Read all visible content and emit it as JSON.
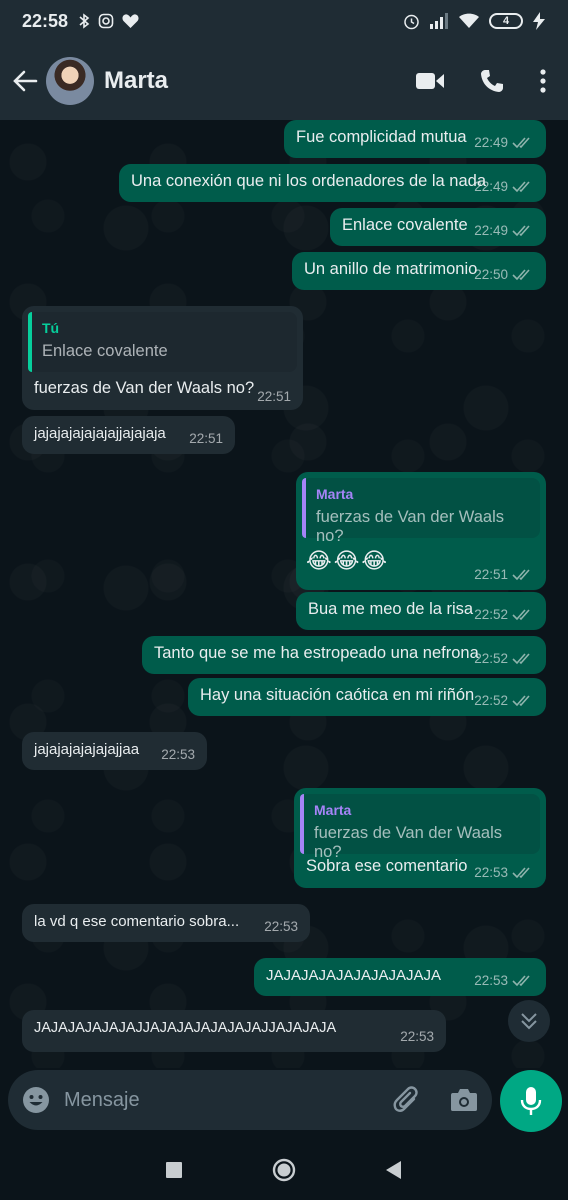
{
  "status_bar": {
    "time": "22:58",
    "battery": "4"
  },
  "header": {
    "contact_name": "Marta"
  },
  "messages": [
    {
      "text": "Fue complicidad mutua",
      "time": "22:49",
      "dir": "out"
    },
    {
      "text": "Una conexión que ni los ordenadores de la nada",
      "time": "22:49",
      "dir": "out"
    },
    {
      "text": "Enlace covalente",
      "time": "22:49",
      "dir": "out"
    },
    {
      "text": "Un anillo de matrimonio",
      "time": "22:50",
      "dir": "out"
    },
    {
      "quote_author": "Tú",
      "quote_text": "Enlace covalente",
      "text": "fuerzas de Van der Waals no?",
      "time": "22:51",
      "dir": "in"
    },
    {
      "text": "jajajajajajajajjajajaja",
      "time": "22:51",
      "dir": "in"
    },
    {
      "quote_author": "Marta",
      "quote_text": "fuerzas de Van der Waals no?",
      "text": "😂😂😂",
      "time": "22:51",
      "dir": "out"
    },
    {
      "text": "Bua me meo de la risa",
      "time": "22:52",
      "dir": "out"
    },
    {
      "text": "Tanto que se me ha estropeado una nefrona",
      "time": "22:52",
      "dir": "out"
    },
    {
      "text": "Hay una situación caótica en mi riñón",
      "time": "22:52",
      "dir": "out"
    },
    {
      "text": "jajajajajajajajjaa",
      "time": "22:53",
      "dir": "in"
    },
    {
      "quote_author": "Marta",
      "quote_text": "fuerzas de Van der Waals no?",
      "text": "Sobra ese comentario",
      "time": "22:53",
      "dir": "out"
    },
    {
      "text": "la vd q ese comentario sobra...",
      "time": "22:53",
      "dir": "in"
    },
    {
      "text": "JAJAJAJAJAJAJAJAJAJA",
      "time": "22:53",
      "dir": "out"
    },
    {
      "text": "JAJAJAJAJAJAJJAJAJAJAJAJAJAJJAJAJAJA",
      "time": "22:53",
      "dir": "in"
    }
  ],
  "composer": {
    "placeholder": "Mensaje"
  },
  "colors": {
    "outgoing_bubble": "#005c4b",
    "incoming_bubble": "#202c33",
    "accent": "#00a884",
    "read_ticks": "#8fb4ad"
  }
}
